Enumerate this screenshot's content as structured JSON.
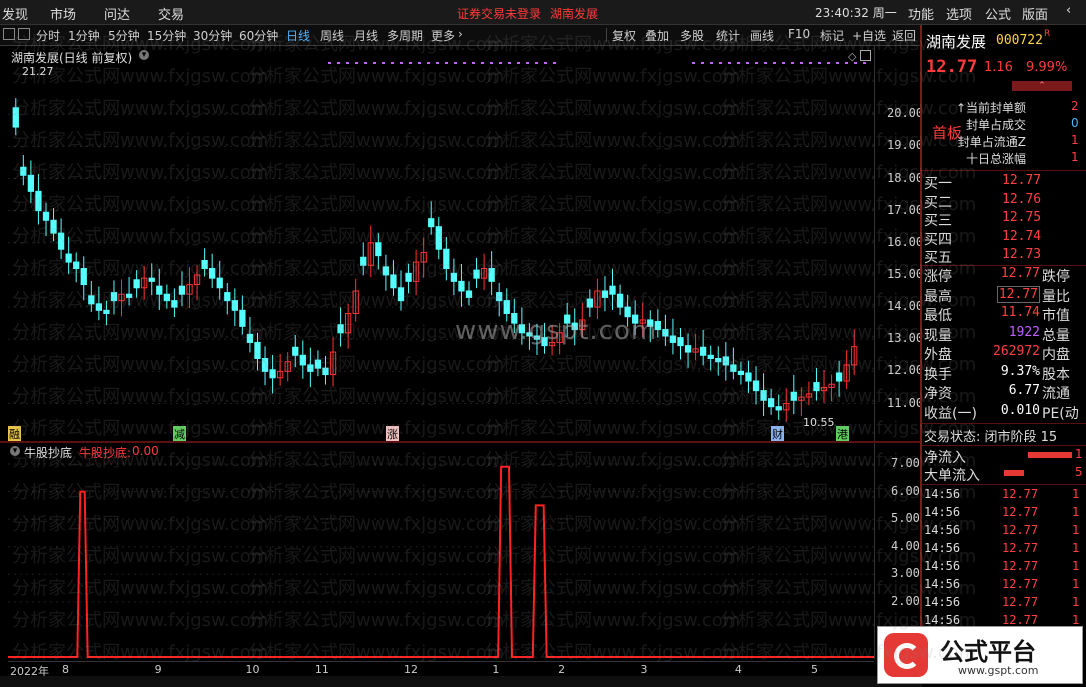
{
  "menu": {
    "items": [
      "发现",
      "市场",
      "问达",
      "交易"
    ],
    "notice": "证券交易未登录",
    "stock_link": "湖南发展",
    "clock": "23:40:32 周一",
    "right_items": [
      "功能",
      "选项",
      "公式",
      "版面"
    ]
  },
  "periods": [
    "分时",
    "1分钟",
    "5分钟",
    "15分钟",
    "30分钟",
    "60分钟",
    "日线",
    "周线",
    "月线",
    "多周期",
    "更多"
  ],
  "active_period": "日线",
  "tools": [
    "复权",
    "叠加",
    "多股",
    "统计",
    "画线",
    "F10",
    "标记",
    "+自选",
    "返回"
  ],
  "main": {
    "title": "湖南发展(日线 前复权)",
    "high_label": "21.27",
    "low_label": "10.55",
    "markers": [
      "融",
      "减",
      "涨",
      "财",
      "港"
    ]
  },
  "main_yaxis": [
    "20.00",
    "19.00",
    "18.00",
    "17.00",
    "16.00",
    "15.00",
    "14.00",
    "13.00",
    "12.00",
    "11.00"
  ],
  "sub": {
    "title": "牛股抄底",
    "label": "牛股抄底:",
    "value": "0.00"
  },
  "sub_yaxis": [
    "7.00",
    "6.00",
    "5.00",
    "4.00",
    "3.00",
    "2.00"
  ],
  "xaxis": [
    "2022年",
    "8",
    "9",
    "10",
    "11",
    "12",
    "1",
    "2",
    "3",
    "4",
    "5"
  ],
  "quote": {
    "name": "湖南发展",
    "code": "000722",
    "flag": "R",
    "price": "12.77",
    "change": "1.16",
    "pct": "9.99%",
    "tag": "首板",
    "seal": [
      {
        "label": "↑当前封单额",
        "value": "2"
      },
      {
        "label": "封单占成交",
        "value": "0"
      },
      {
        "label": "封单占流通Z",
        "value": "1"
      },
      {
        "label": "十日总涨幅",
        "value": "1"
      }
    ],
    "bids": [
      {
        "label": "买一",
        "price": "12.77"
      },
      {
        "label": "买二",
        "price": "12.76"
      },
      {
        "label": "买三",
        "price": "12.75"
      },
      {
        "label": "买四",
        "price": "12.74"
      },
      {
        "label": "买五",
        "price": "12.73"
      }
    ],
    "stats": [
      {
        "l1": "涨停",
        "v1": "12.77",
        "l2": "跌停"
      },
      {
        "l1": "最高",
        "v1": "12.77",
        "l2": "量比"
      },
      {
        "l1": "最低",
        "v1": "11.74",
        "l2": "市值"
      },
      {
        "l1": "现量",
        "v1": "1922",
        "l2": "总量"
      },
      {
        "l1": "外盘",
        "v1": "262972",
        "l2": "内盘"
      },
      {
        "l1": "换手",
        "v1": "9.37%",
        "l2": "股本"
      },
      {
        "l1": "净资",
        "v1": "6.77",
        "l2": "流通"
      },
      {
        "l1": "收益(一)",
        "v1": "0.010",
        "l2": "PE(动"
      }
    ],
    "trade_state": "交易状态: 闭市阶段 15",
    "flows": [
      {
        "label": "净流入",
        "value": "1"
      },
      {
        "label": "大单流入",
        "value": "5"
      }
    ],
    "ticks": [
      {
        "t": "14:56",
        "p": "12.77",
        "v": "1"
      },
      {
        "t": "14:56",
        "p": "12.77",
        "v": "1"
      },
      {
        "t": "14:56",
        "p": "12.77",
        "v": "1"
      },
      {
        "t": "14:56",
        "p": "12.77",
        "v": "1"
      },
      {
        "t": "14:56",
        "p": "12.77",
        "v": "1"
      },
      {
        "t": "14:56",
        "p": "12.77",
        "v": "1"
      },
      {
        "t": "14:56",
        "p": "12.77",
        "v": "1"
      },
      {
        "t": "14:56",
        "p": "12.77",
        "v": "1"
      }
    ]
  },
  "watermark": "分析家公式网www.fxjgsw.com",
  "center_watermark": "www.gspt.com",
  "logo": {
    "text": "公式平台",
    "url": "www.gspt.com"
  },
  "colors": {
    "up": "#ff3232",
    "down": "#54ffff",
    "sub_line": "#ff2020"
  },
  "chart_data": {
    "type": "candlestick",
    "title": "湖南发展(日线 前复权)",
    "ylim": [
      10.3,
      21.5
    ],
    "closes": [
      19.6,
      18.1,
      17.6,
      17.0,
      16.7,
      16.3,
      15.8,
      15.4,
      15.2,
      14.7,
      14.1,
      13.9,
      13.8,
      14.2,
      14.4,
      14.3,
      14.6,
      14.9,
      14.8,
      14.4,
      14.2,
      14.0,
      14.4,
      14.7,
      15.0,
      15.2,
      14.9,
      14.6,
      14.2,
      13.9,
      13.4,
      12.9,
      12.4,
      12.0,
      11.8,
      12.0,
      12.3,
      12.5,
      12.2,
      12.0,
      12.1,
      11.9,
      12.6,
      13.2,
      13.8,
      14.5,
      15.3,
      16.0,
      15.6,
      15.0,
      14.6,
      14.2,
      14.8,
      15.4,
      15.7,
      16.5,
      15.8,
      15.2,
      14.8,
      14.5,
      14.3,
      14.9,
      15.2,
      14.8,
      14.2,
      13.8,
      13.5,
      13.2,
      13.1,
      13.0,
      12.8,
      12.9,
      13.2,
      13.5,
      13.3,
      13.6,
      14.0,
      14.5,
      14.3,
      14.4,
      14.0,
      13.7,
      13.5,
      13.6,
      13.4,
      13.3,
      13.1,
      12.9,
      12.8,
      12.6,
      12.7,
      12.5,
      12.4,
      12.3,
      12.2,
      12.0,
      11.9,
      11.7,
      11.4,
      11.1,
      10.9,
      10.8,
      11.0,
      11.1,
      11.2,
      11.3,
      11.4,
      11.5,
      11.6,
      11.7,
      12.2,
      12.77
    ]
  },
  "sub_data": {
    "ylim": [
      0,
      7.4
    ],
    "signals": [
      {
        "start": 0.08,
        "end": 0.092,
        "value": 6.0
      },
      {
        "start": 0.566,
        "end": 0.582,
        "value": 6.9
      },
      {
        "start": 0.606,
        "end": 0.622,
        "value": 5.5
      }
    ]
  }
}
